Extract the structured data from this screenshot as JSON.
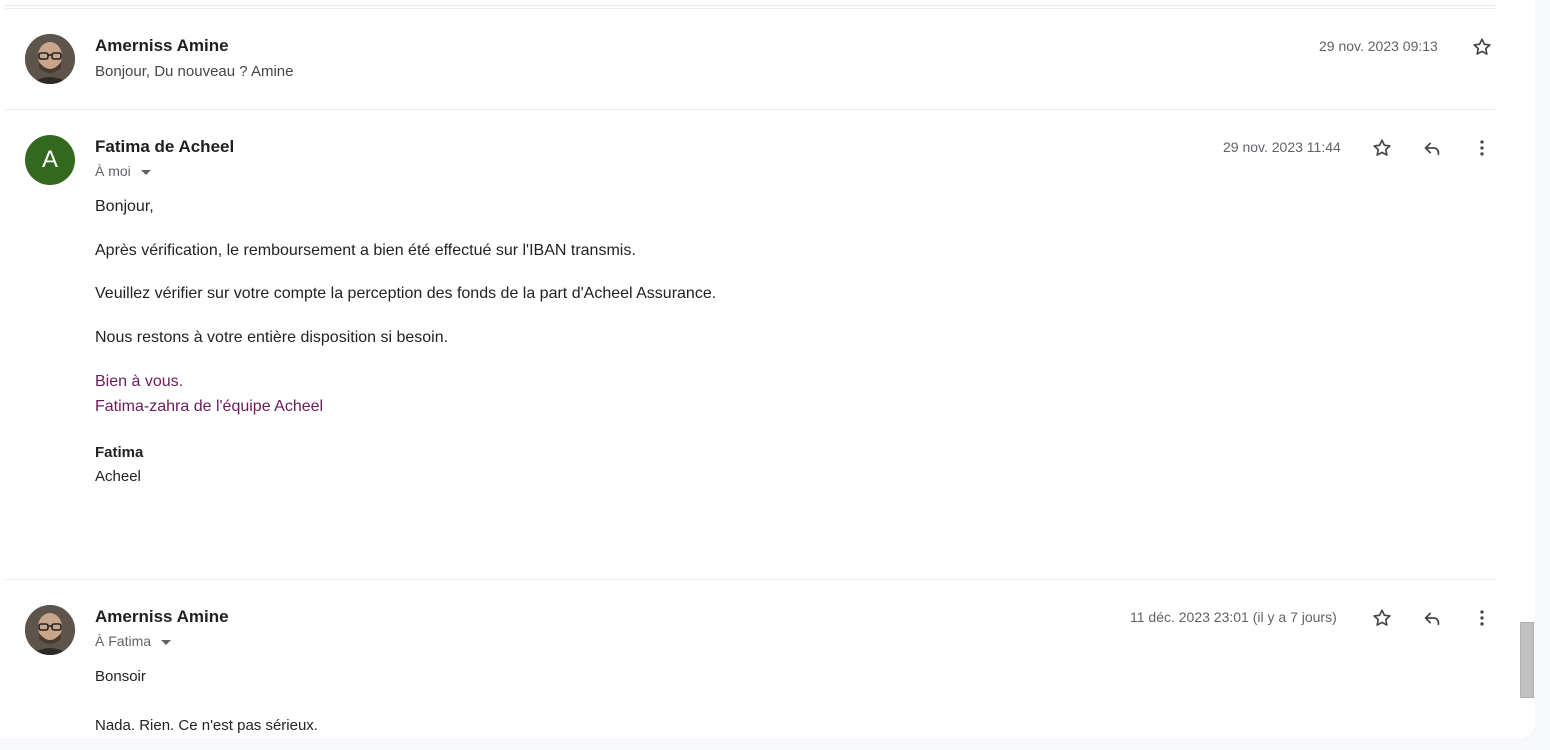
{
  "messages": [
    {
      "sender": "Amerniss Amine",
      "snippet": "Bonjour, Du nouveau ? Amine",
      "date": "29 nov. 2023 09:13"
    },
    {
      "sender": "Fatima de Acheel",
      "avatar_letter": "A",
      "avatar_color": "#33691e",
      "to": "À moi",
      "date": "29 nov. 2023 11:44",
      "body": {
        "greeting": "Bonjour,",
        "p1": "Après vérification, le remboursement a bien été effectué sur l'IBAN transmis.",
        "p2": "Veuillez vérifier sur votre compte la perception des fonds de la part d'Acheel Assurance.",
        "p3": "Nous restons à votre entière disposition si besoin.",
        "sig1": "Bien à vous.",
        "sig2": "Fatima-zahra de l'équipe Acheel",
        "sig_name": "Fatima",
        "sig_company": "Acheel"
      }
    },
    {
      "sender": "Amerniss Amine",
      "to": "À Fatima",
      "date": "11 déc. 2023 23:01 (il y a 7 jours)",
      "body": {
        "line1": "Bonsoir",
        "line2": "Nada. Rien. Ce n'est pas sérieux."
      }
    }
  ],
  "colors": {
    "signature": "#6a1b5a",
    "icon": "#444746"
  },
  "icons": {
    "star": "star-icon",
    "reply": "reply-icon",
    "more": "more-vert-icon"
  }
}
